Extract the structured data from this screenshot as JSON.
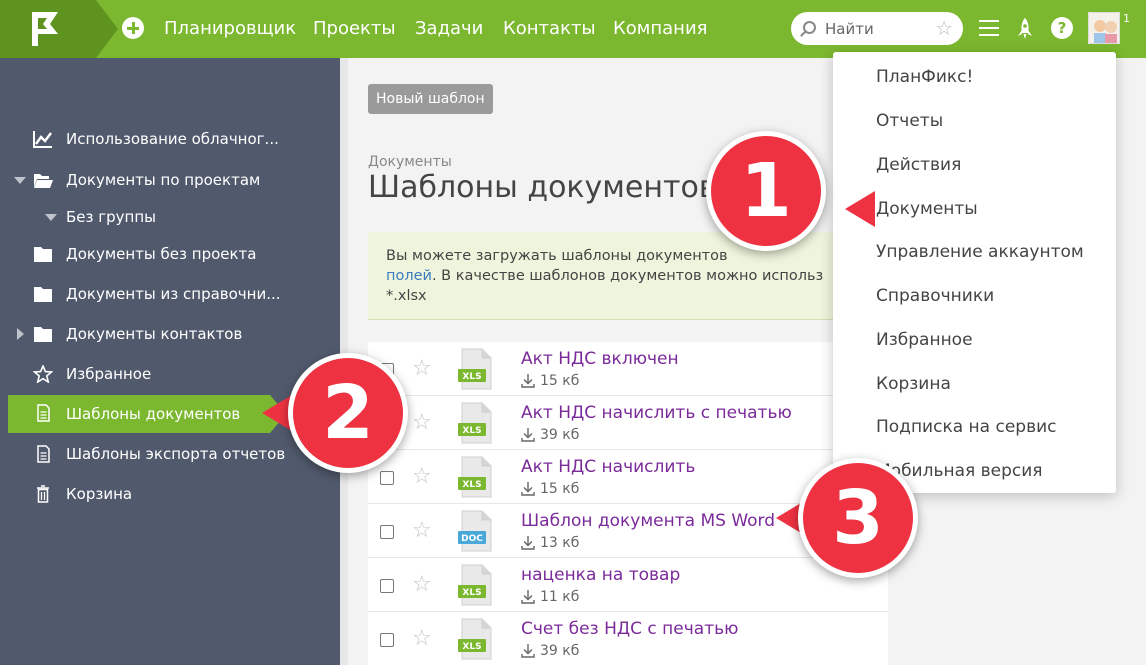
{
  "topbar": {
    "nav": [
      "Планировщик",
      "Проекты",
      "Задачи",
      "Контакты",
      "Компания"
    ],
    "search_placeholder": "Найти",
    "notification_count": "1"
  },
  "sidebar": {
    "items": [
      {
        "label": "Использование облачног...",
        "icon": "chart-icon"
      },
      {
        "label": "Документы по проектам",
        "icon": "folder-open-icon"
      },
      {
        "label": "Без группы",
        "icon": "caret-down-icon"
      },
      {
        "label": "Документы без проекта",
        "icon": "folder-icon"
      },
      {
        "label": "Документы из справочни...",
        "icon": "folder-icon"
      },
      {
        "label": "Документы контактов",
        "icon": "folder-icon"
      },
      {
        "label": "Избранное",
        "icon": "star-icon"
      },
      {
        "label": "Шаблоны документов",
        "icon": "document-icon",
        "active": true
      },
      {
        "label": "Шаблоны экспорта отчетов",
        "icon": "document-icon"
      },
      {
        "label": "Корзина",
        "icon": "trash-icon"
      }
    ]
  },
  "main": {
    "new_template_label": "Новый шаблон",
    "breadcrumb": "Документы",
    "title": "Шаблоны документов",
    "info_text_1": "Вы можете загружать шаблоны документов",
    "info_link": "полей",
    "info_text_2": ". В качестве шаблонов документов можно использ",
    "info_text_3": "*.xlsx",
    "documents": [
      {
        "name": "Акт НДС включен",
        "size": "15 кб",
        "type": "XLS"
      },
      {
        "name": "Акт НДС начислить с печатью",
        "size": "39 кб",
        "type": "XLS"
      },
      {
        "name": "Акт НДС начислить",
        "size": "15 кб",
        "type": "XLS"
      },
      {
        "name": "Шаблон документа MS Word",
        "size": "13 кб",
        "type": "DOC"
      },
      {
        "name": "наценка на товар",
        "size": "11 кб",
        "type": "XLS"
      },
      {
        "name": "Счет без НДС с печатью",
        "size": "39 кб",
        "type": "XLS"
      }
    ]
  },
  "menu": {
    "items": [
      "ПланФикс!",
      "Отчеты",
      "Действия",
      "Документы",
      "Управление аккаунтом",
      "Справочники",
      "Избранное",
      "Корзина",
      "Подписка на сервис",
      "Мобильная версия"
    ]
  },
  "callouts": [
    "1",
    "2",
    "3"
  ],
  "colors": {
    "brand_green": "#7cb82f",
    "sidebar_bg": "#515a6d",
    "callout_red": "#ee3241",
    "link_purple": "#7b2a9a",
    "xls_green": "#7cb82f",
    "doc_blue": "#4aa8d8"
  }
}
